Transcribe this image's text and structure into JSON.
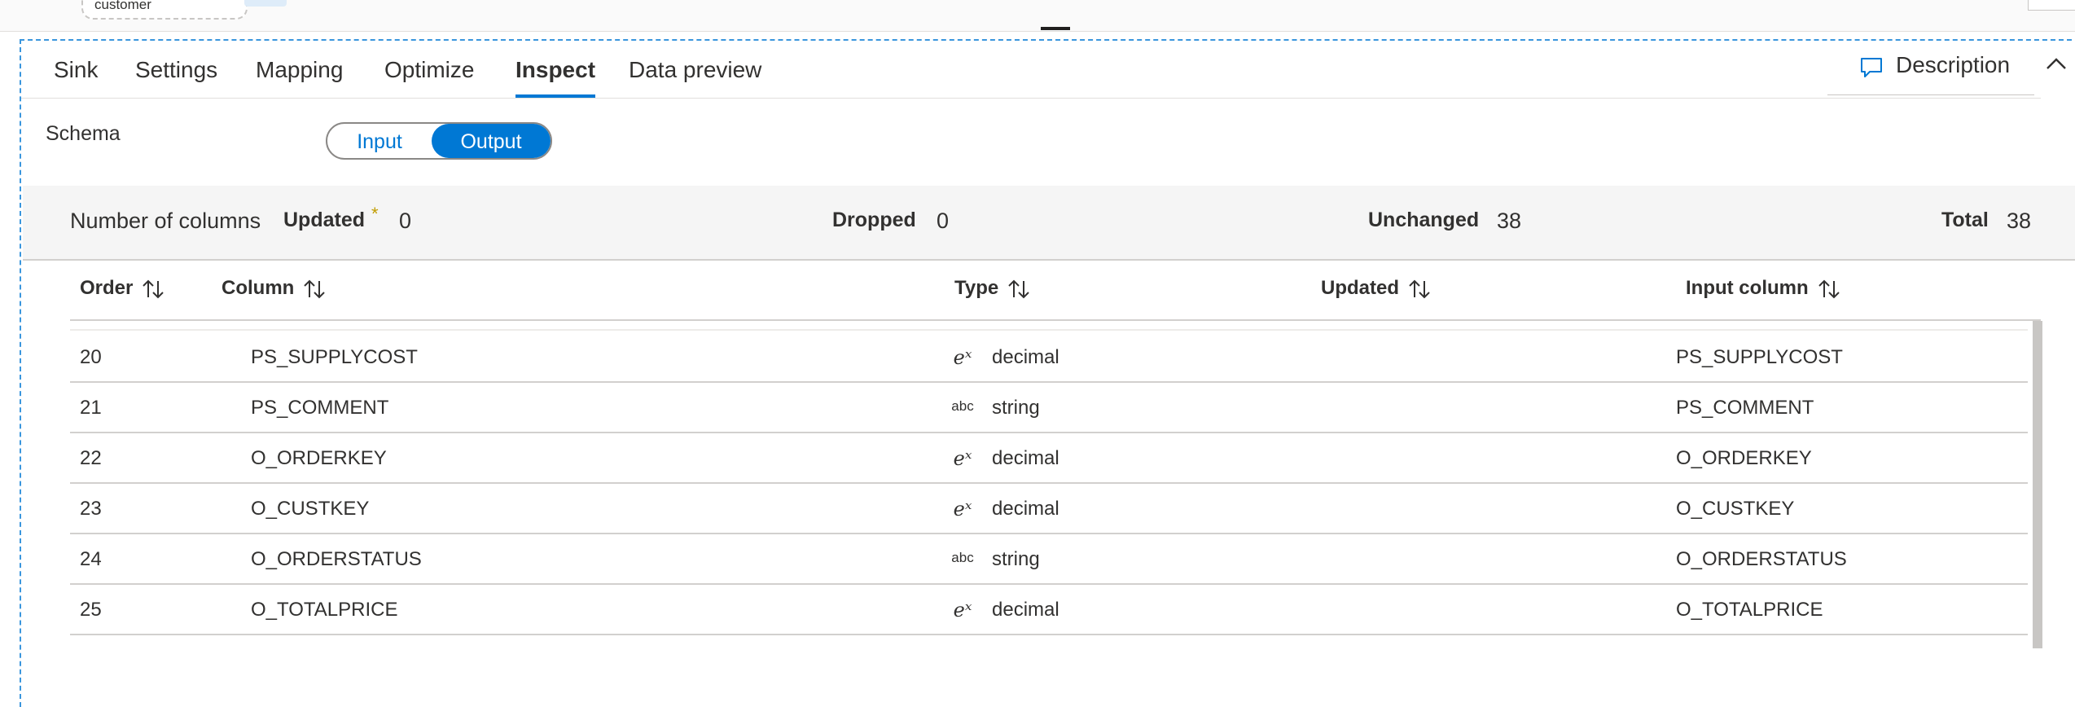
{
  "canvas": {
    "node_label": "customer"
  },
  "tabs": [
    {
      "label": "Sink",
      "active": false
    },
    {
      "label": "Settings",
      "active": false
    },
    {
      "label": "Mapping",
      "active": false
    },
    {
      "label": "Optimize",
      "active": false
    },
    {
      "label": "Inspect",
      "active": true
    },
    {
      "label": "Data preview",
      "active": false
    }
  ],
  "description": {
    "label": "Description",
    "icon": "comment-icon"
  },
  "collapse": {
    "icon": "chevron-up-icon"
  },
  "schema": {
    "label": "Schema",
    "toggle": {
      "options": [
        "Input",
        "Output"
      ],
      "selected": "Output"
    }
  },
  "summary": {
    "title": "Number of columns",
    "updated_label": "Updated",
    "updated_marker": "*",
    "updated_value": "0",
    "dropped_label": "Dropped",
    "dropped_value": "0",
    "unchanged_label": "Unchanged",
    "unchanged_value": "38",
    "total_label": "Total",
    "total_value": "38"
  },
  "table": {
    "headers": [
      "Order",
      "Column",
      "Type",
      "Updated",
      "Input column"
    ],
    "sort_icon": "sort-arrows-icon",
    "rows": [
      {
        "order": "20",
        "column": "PS_SUPPLYCOST",
        "type_icon": "eˣ",
        "type_icon_name": "decimal-icon",
        "type": "decimal",
        "updated": "",
        "input": "PS_SUPPLYCOST"
      },
      {
        "order": "21",
        "column": "PS_COMMENT",
        "type_icon": "abc",
        "type_icon_name": "string-icon",
        "type": "string",
        "updated": "",
        "input": "PS_COMMENT"
      },
      {
        "order": "22",
        "column": "O_ORDERKEY",
        "type_icon": "eˣ",
        "type_icon_name": "decimal-icon",
        "type": "decimal",
        "updated": "",
        "input": "O_ORDERKEY"
      },
      {
        "order": "23",
        "column": "O_CUSTKEY",
        "type_icon": "eˣ",
        "type_icon_name": "decimal-icon",
        "type": "decimal",
        "updated": "",
        "input": "O_CUSTKEY"
      },
      {
        "order": "24",
        "column": "O_ORDERSTATUS",
        "type_icon": "abc",
        "type_icon_name": "string-icon",
        "type": "string",
        "updated": "",
        "input": "O_ORDERSTATUS"
      },
      {
        "order": "25",
        "column": "O_TOTALPRICE",
        "type_icon": "eˣ",
        "type_icon_name": "decimal-icon",
        "type": "decimal",
        "updated": "",
        "input": "O_TOTALPRICE"
      }
    ]
  },
  "colors": {
    "accent": "#0078d4",
    "selection_border": "#3a96dd",
    "updated_marker": "#c19c00"
  }
}
